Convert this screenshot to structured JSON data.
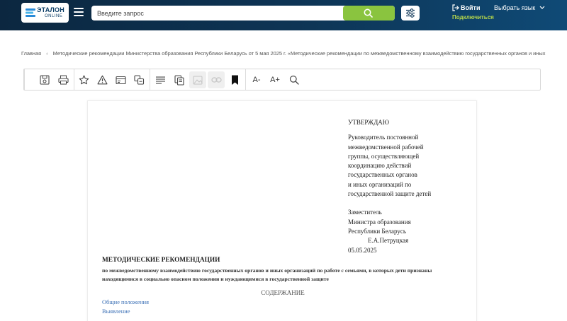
{
  "header": {
    "logo_brand": "ЭТАЛОН",
    "logo_sub": "ONLINE",
    "search_placeholder": "Введите запрос",
    "login_label": "Войти",
    "language_label": "Выбрать язык",
    "connect_label": "Подключиться",
    "colors": {
      "accent_green": "#8ac43f",
      "header_dark": "#0c2740",
      "link_lime": "#b7d84a"
    }
  },
  "breadcrumb": {
    "home": "Главная",
    "current": "Методические рекомендации Министерства образования Республики Беларусь от 5 мая 2025 г. «Методические рекомендации по межведомственному взаимодействию государственных органов и иных организ..."
  },
  "toolbar": {
    "icons": [
      "save-icon",
      "print-icon",
      "favorite-star-icon",
      "warning-icon",
      "card-icon",
      "compare-icon",
      "list-icon",
      "copy-icon",
      "image-disabled-icon",
      "link-disabled-icon",
      "bookmark-icon",
      "font-decrease-icon",
      "font-increase-icon",
      "search-icon"
    ],
    "font_decrease": "A-",
    "font_increase": "A+"
  },
  "document": {
    "approve_head": "УТВЕРЖДАЮ",
    "approve_lines": [
      "Руководитель постоянной",
      "межведомственной рабочей",
      "группы, осуществляющей",
      "координацию действий",
      "государственных органов",
      "и иных организаций по",
      "государственной защите детей"
    ],
    "signer_lines": [
      "Заместитель",
      "Министра образования",
      "Республики Беларусь"
    ],
    "signer_name": "Е.А.Петруцкая",
    "date": "05.05.2025",
    "title": "МЕТОДИЧЕСКИЕ РЕКОМЕНДАЦИИ",
    "subtitle": "по межведомственному взаимодействию государственных органов и иных организаций по работе с семьями, в которых дети признаны находящимися в социально опасном положении и нуждающимися в государственной защите",
    "toc_title": "СОДЕРЖАНИЕ",
    "toc_items": [
      "Общие положения",
      "Выявление"
    ]
  }
}
